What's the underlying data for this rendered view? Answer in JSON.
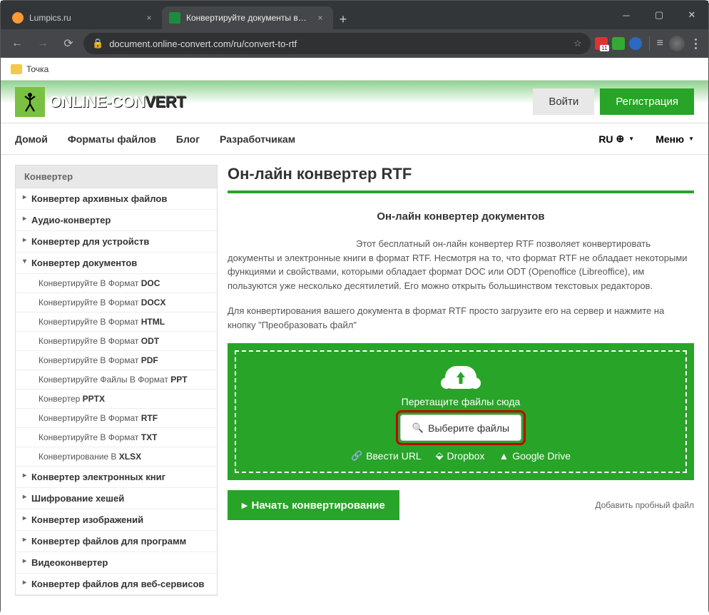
{
  "tabs": [
    {
      "title": "Lumpics.ru"
    },
    {
      "title": "Конвертируйте документы в фо"
    }
  ],
  "url": "document.online-convert.com/ru/convert-to-rtf",
  "bookmark": "Точка",
  "header": {
    "login": "Войти",
    "register": "Регистрация"
  },
  "nav": {
    "items": [
      "Домой",
      "Форматы файлов",
      "Блог",
      "Разработчикам"
    ],
    "lang": "RU",
    "menu": "Меню"
  },
  "sidebar": {
    "title": "Конвертер",
    "items": [
      "Конвертер архивных файлов",
      "Аудио-конвертер",
      "Конвертер для устройств",
      "Конвертер документов",
      "Конвертер электронных книг",
      "Шифрование хешей",
      "Конвертер изображений",
      "Конвертер файлов для программ",
      "Видеоконвертер",
      "Конвертер файлов для веб-сервисов"
    ],
    "subs": [
      {
        "pre": "Конвертируйте В Формат ",
        "b": "DOC"
      },
      {
        "pre": "Конвертируйте В Формат ",
        "b": "DOCX"
      },
      {
        "pre": "Конвертируйте В Формат ",
        "b": "HTML"
      },
      {
        "pre": "Конвертируйте В Формат ",
        "b": "ODT"
      },
      {
        "pre": "Конвертируйте В Формат ",
        "b": "PDF"
      },
      {
        "pre": "Конвертируйте Файлы В Формат ",
        "b": "PPT"
      },
      {
        "pre": "Конвертер ",
        "b": "PPTX"
      },
      {
        "pre": "Конвертируйте В Формат ",
        "b": "RTF"
      },
      {
        "pre": "Конвертируйте В Формат ",
        "b": "TXT"
      },
      {
        "pre": "Конвертирование В ",
        "b": "XLSX"
      }
    ]
  },
  "main": {
    "h1": "Он-лайн конвертер RTF",
    "sub_h": "Он-лайн конвертер документов",
    "p1": "Этот бесплатный он-лайн конвертер RTF позволяет конвертировать документы и электронные книги в формат RTF. Несмотря на то, что формат RTF не обладает некоторыми функциями и свойствами, которыми обладает формат DOC или ODT (Openoffice (Libreoffice), им пользуются уже несколько десятилетий. Его можно открыть большинством текстовых редакторов.",
    "p2": "Для конвертирования вашего документа в формат RTF просто загрузите его на сервер и нажмите на кнопку \"Преобразовать файл\"",
    "drop": "Перетащите файлы сюда",
    "choose": "Выберите файлы",
    "url": "Ввести URL",
    "dropbox": "Dropbox",
    "gdrive": "Google Drive",
    "start": "Начать конвертирование",
    "sample": "Добавить пробный файл"
  }
}
